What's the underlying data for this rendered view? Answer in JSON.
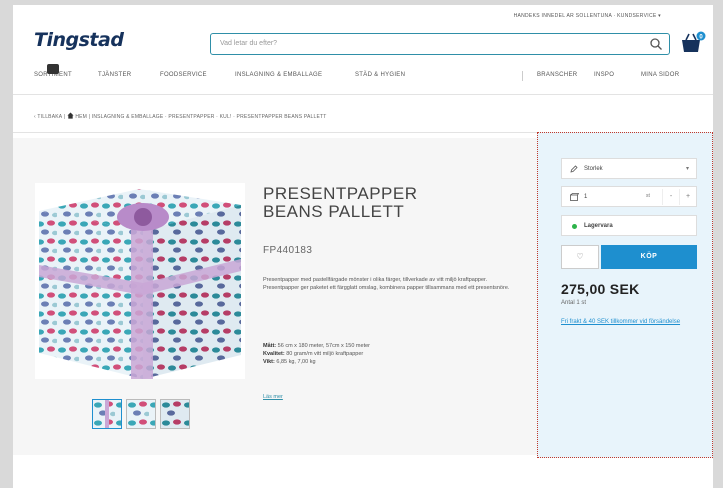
{
  "header": {
    "top_links": "HANDEKS INNEDEL AR SOLLENTUNA · KUNDSERVICE ▾",
    "logo": "Tingstad",
    "search_placeholder": "Vad letar du efter?"
  },
  "nav": {
    "items": [
      "SORTIMENT",
      "TJÄNSTER",
      "FOODSERVICE",
      "INSLAGNING & EMBALLAGE",
      "STÄD & HYGIEN"
    ],
    "right_items": [
      "BRANSCHER",
      "INSPO",
      "MINA SIDOR"
    ]
  },
  "breadcrumb": {
    "back": "‹ TILLBAKA",
    "home": "HEM",
    "path": "INSLAGNING & EMBALLAGE · PRESENTPAPPER · KUL! · PRESENTPAPPER BEANS PALLETT"
  },
  "product": {
    "title_line1": "PRESENTPAPPER",
    "title_line2": "BEANS PALLETT",
    "sku": "FP440183",
    "description": "Presentpapper med pastellfärgade mönster i olika färger, tillverkade av vitt miljö kraftpapper. Presentpapper ger paketet ett färgglatt omslag, kombinera papper tillsammans med ett presentsnöre.",
    "spec_size_label": "Mått:",
    "spec_size": "56 cm x 180 meter, 57cm x 150 meter",
    "spec_quality_label": "Kvalitet:",
    "spec_quality": "80 gram/m vitt miljö kraftpapper",
    "spec_weight_label": "Vikt:",
    "spec_weight": "6,85 kg, 7,00 kg",
    "read_more": "Läs mer"
  },
  "buybox": {
    "size_select": "Storlek",
    "qty_value": "1",
    "qty_unit": "st",
    "qty_minus": "-",
    "qty_plus": "+",
    "stock": "Lagervara",
    "fav_icon": "heart-icon",
    "buy_label": "KÖP",
    "price": "275,00 SEK",
    "price_note": "Antal 1 st",
    "freight_link": "Fri frakt & 40 SEK tillkommer vid försändelse"
  },
  "colors": {
    "brand": "#16325c",
    "accent": "#1e8fcf",
    "search_border": "#2f8fa8",
    "stock_green": "#2db34a"
  }
}
